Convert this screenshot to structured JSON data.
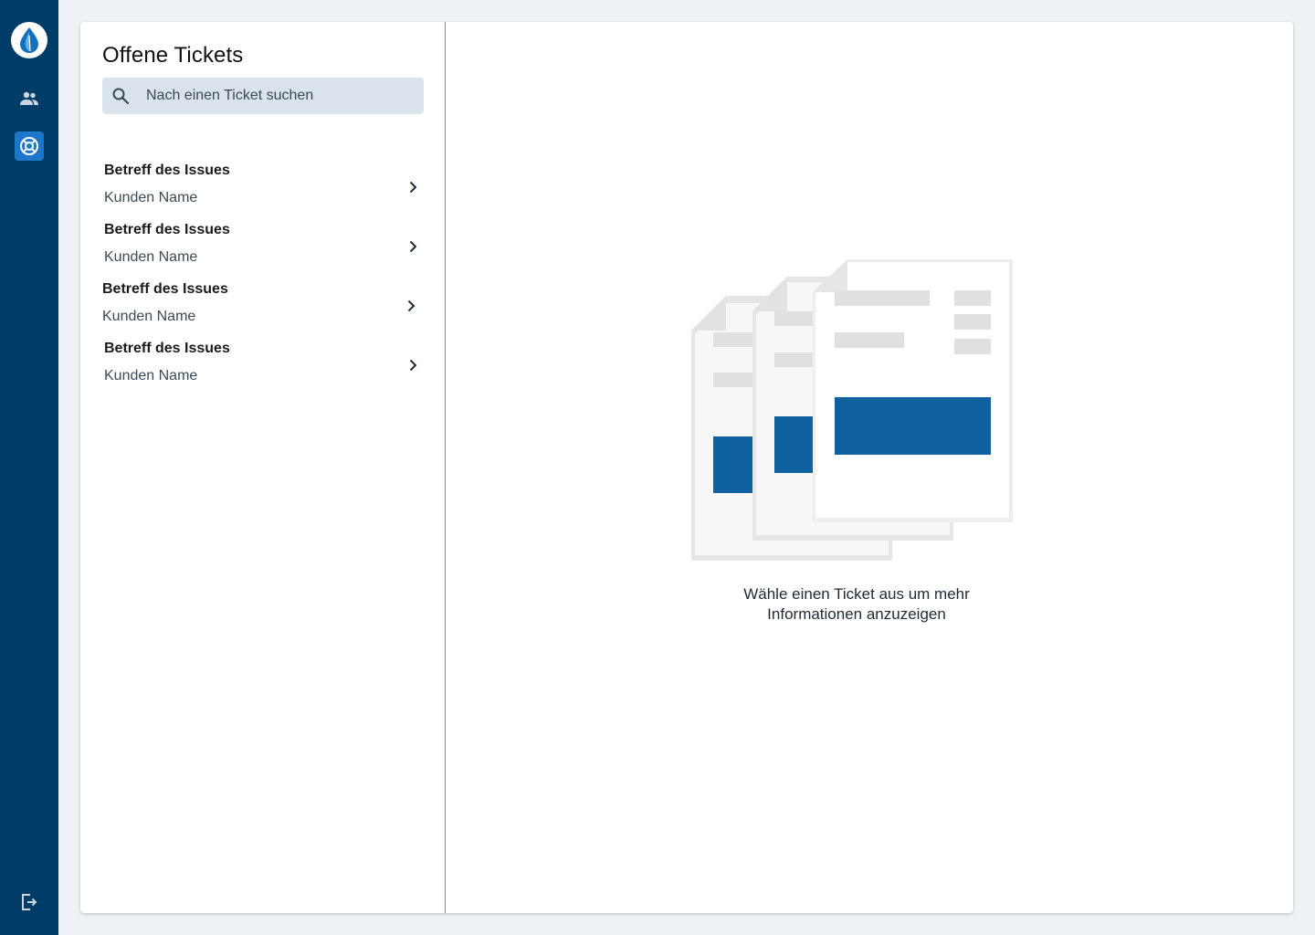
{
  "nav": {
    "items": [
      {
        "icon": "people-icon",
        "label": ""
      },
      {
        "icon": "lifebuoy-icon",
        "label": "",
        "active": true
      }
    ],
    "logout_icon": "logout-icon",
    "accent_color": "#003c68",
    "active_color": "#1d77c9"
  },
  "list": {
    "title": "Offene Tickets",
    "search": {
      "placeholder": "Nach einen Ticket suchen",
      "value": ""
    },
    "tickets": [
      {
        "subject": "Betreff des Issues",
        "customer": "Kunden Name"
      },
      {
        "subject": "Betreff des Issues",
        "customer": "Kunden Name"
      },
      {
        "subject": "Betreff des Issues",
        "customer": "Kunden Name"
      },
      {
        "subject": "Betreff des Issues",
        "customer": "Kunden Name"
      }
    ]
  },
  "detail": {
    "empty_message": "Wähle einen Ticket aus um mehr Informationen anzuzeigen",
    "illustration_accent": "#1061a0"
  }
}
